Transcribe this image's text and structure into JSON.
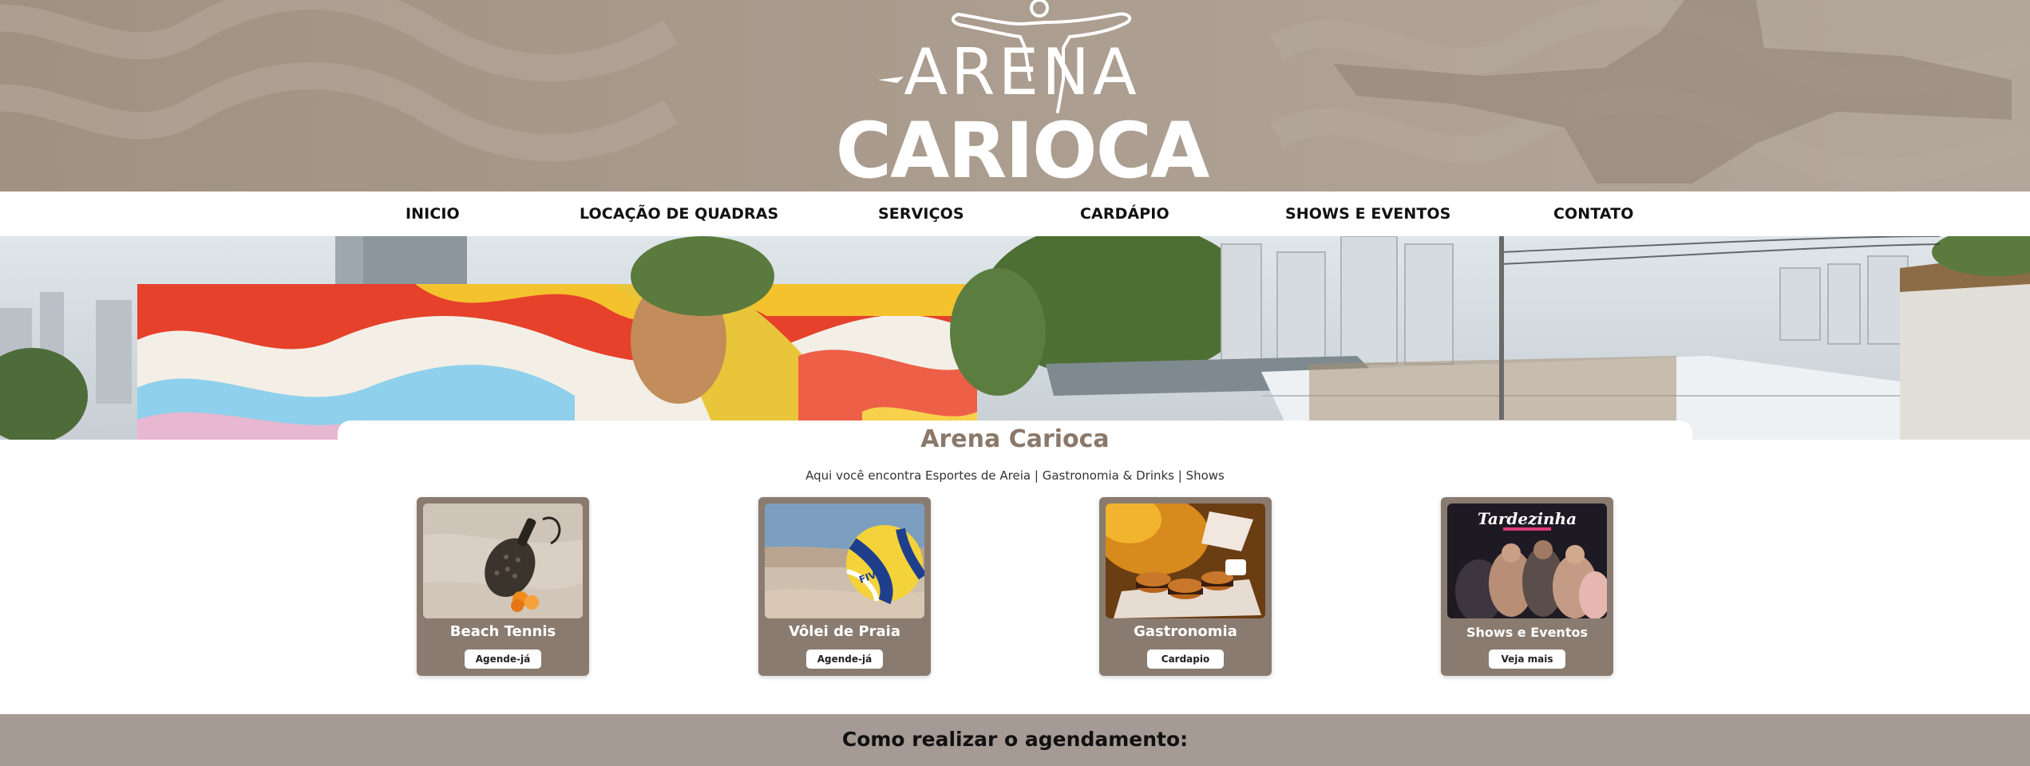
{
  "brand": {
    "line1": "ARENA",
    "line2": "CARIOCA",
    "header_color": "#a89a8c"
  },
  "nav": {
    "items": [
      {
        "label": "INICIO"
      },
      {
        "label": "LOCAÇÃO DE QUADRAS"
      },
      {
        "label": "SERVIÇOS"
      },
      {
        "label": "CARDÁPIO"
      },
      {
        "label": "SHOWS E EVENTOS"
      },
      {
        "label": "CONTATO"
      }
    ]
  },
  "main": {
    "title": "Arena Carioca",
    "tagline": "Aqui você encontra Esportes de Areia | Gastronomia & Drinks | Shows",
    "accent_color": "#8a786a"
  },
  "services": [
    {
      "title": "Beach Tennis",
      "button": "Agende-já",
      "icon": "beach-tennis-photo"
    },
    {
      "title": "Vôlei de Praia",
      "button": "Agende-já",
      "icon": "beach-volleyball-photo"
    },
    {
      "title": "Gastronomia",
      "button": "Cardapio",
      "icon": "burgers-photo"
    },
    {
      "title": "Shows e Eventos",
      "button": "Veja mais",
      "icon": "party-photo",
      "photo_caption": "Tardezinha"
    }
  ],
  "scheduling": {
    "title": "Como realizar o agendamento:",
    "band_color": "#a59a94"
  }
}
